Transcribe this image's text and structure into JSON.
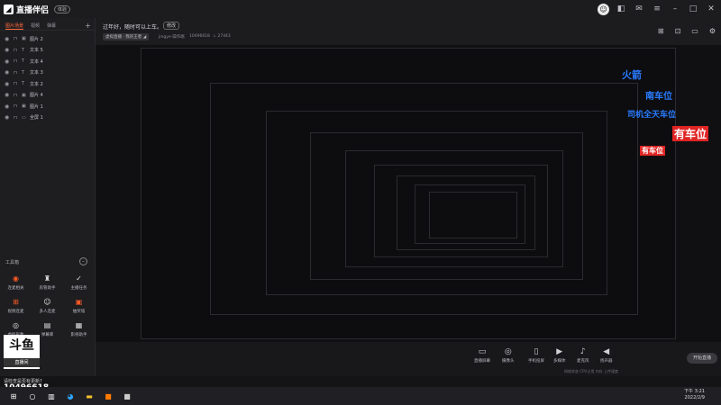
{
  "app": {
    "name": "直播伴侣",
    "version_badge": "体验"
  },
  "layer_tabs": [
    "图片场景",
    "视频",
    "弹幕"
  ],
  "layers": [
    {
      "type": "img",
      "label": "图片 2"
    },
    {
      "type": "txt",
      "label": "文本 5"
    },
    {
      "type": "txt",
      "label": "文本 4"
    },
    {
      "type": "txt",
      "label": "文本 3"
    },
    {
      "type": "txt",
      "label": "文本 2"
    },
    {
      "type": "img",
      "label": "图片 4"
    },
    {
      "type": "img",
      "label": "图片 1"
    },
    {
      "type": "cap",
      "label": "全屏 1"
    }
  ],
  "toolbox": {
    "title": "工具箱"
  },
  "tools": [
    {
      "label": "连麦相关",
      "icon": "broadcast-icon",
      "glyph": "◉",
      "orange": true
    },
    {
      "label": "房管助手",
      "icon": "shield-icon",
      "glyph": "♜",
      "orange": false
    },
    {
      "label": "主播任务",
      "icon": "task-icon",
      "glyph": "✓",
      "orange": false
    },
    {
      "label": "视频连麦",
      "icon": "video-link-icon",
      "glyph": "⊞",
      "orange": true
    },
    {
      "label": "多人连麦",
      "icon": "group-icon",
      "glyph": "☺",
      "orange": false
    },
    {
      "label": "抽奖墙",
      "icon": "gift-icon",
      "glyph": "▣",
      "orange": true
    },
    {
      "label": "虚拟形象",
      "icon": "avatar-icon",
      "glyph": "◎",
      "orange": false
    },
    {
      "label": "弹幕库",
      "icon": "danmu-icon",
      "glyph": "▤",
      "orange": false
    },
    {
      "label": "影视助手",
      "icon": "film-icon",
      "glyph": "▦",
      "orange": false
    }
  ],
  "brand_logo": "斗鱼",
  "brand_sub": "直播间",
  "room_id": "10496618",
  "header": {
    "notice": "过年好，随时可以上车。",
    "edit": "修改",
    "tag": "虚拟直播 · 我的王者 ◢",
    "uploader": "jingye·操作端",
    "room": "10496618",
    "fans": "♨ 27443"
  },
  "controls": [
    {
      "label": "直播屏幕",
      "icon": "screen-icon",
      "glyph": "▭"
    },
    {
      "label": "摄像头",
      "icon": "camera-icon",
      "glyph": "◎"
    },
    {
      "label": "手机投屏",
      "icon": "phone-icon",
      "glyph": "▯"
    },
    {
      "label": "多媒体",
      "icon": "media-icon",
      "glyph": "▶"
    },
    {
      "label": "麦克风",
      "icon": "mic-icon",
      "glyph": "♪"
    },
    {
      "label": "扬声器",
      "icon": "speaker-icon",
      "glyph": "◀"
    }
  ],
  "start_button": "开始直播",
  "danmu": [
    {
      "text": "火箭",
      "color": "#2a7bff"
    },
    {
      "text": "南车位",
      "color": "#2a7bff"
    },
    {
      "text": "司机全天车位",
      "color": "#2a7bff"
    },
    {
      "text": "有车位",
      "color": "#ffffff"
    },
    {
      "text": "有车位",
      "color": "#ffffff"
    }
  ],
  "danmu_highlight": "#e02424",
  "warning": "请检查是否有更新?",
  "status_bar": "网络状态  CPU占用  内存  上传速度",
  "clock": {
    "time": "下午 3:21",
    "date": "2022/2/9"
  },
  "taskbar_apps": [
    {
      "icon": "windows-icon",
      "glyph": "⊞",
      "color": "#ffffff"
    },
    {
      "icon": "search-icon",
      "glyph": "○",
      "color": "#ffffff"
    },
    {
      "icon": "taskview-icon",
      "glyph": "▥",
      "color": "#ffffff"
    },
    {
      "icon": "edge-icon",
      "glyph": "◕",
      "color": "#2fa3ff"
    },
    {
      "icon": "folder-icon",
      "glyph": "▬",
      "color": "#f5c22b"
    },
    {
      "icon": "app-icon",
      "glyph": "■",
      "color": "#ff7a00"
    },
    {
      "icon": "app2-icon",
      "glyph": "■",
      "color": "#cccccc"
    }
  ]
}
